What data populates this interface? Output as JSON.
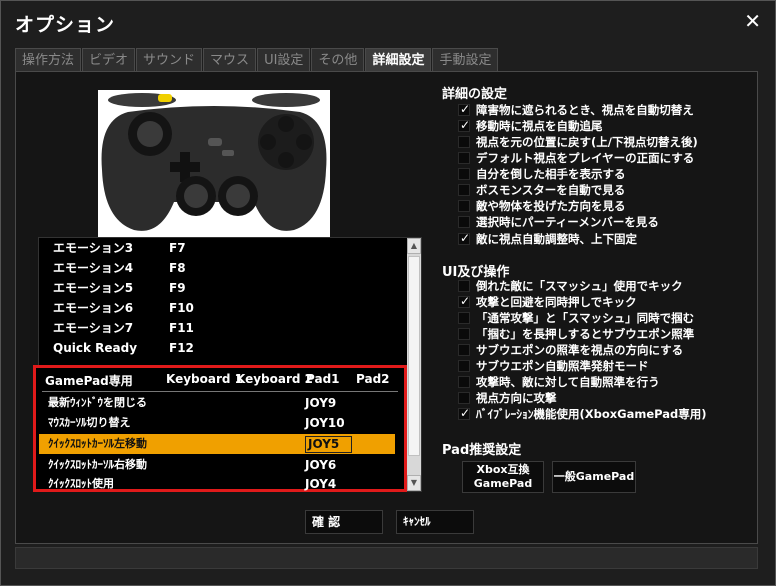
{
  "window": {
    "title": "オプション",
    "close_glyph": "✕"
  },
  "tabs": [
    {
      "label": "操作方法"
    },
    {
      "label": "ビデオ"
    },
    {
      "label": "サウンド"
    },
    {
      "label": "マウス"
    },
    {
      "label": "UI設定"
    },
    {
      "label": "その他"
    },
    {
      "label": "詳細設定"
    },
    {
      "label": "手動設定"
    }
  ],
  "keylist": {
    "rows": [
      {
        "name": "エモーション3",
        "key": "F7"
      },
      {
        "name": "エモーション4",
        "key": "F8"
      },
      {
        "name": "エモーション5",
        "key": "F9"
      },
      {
        "name": "エモーション6",
        "key": "F10"
      },
      {
        "name": "エモーション7",
        "key": "F11"
      },
      {
        "name": "Quick Ready",
        "key": "F12"
      }
    ],
    "scroll_up": "▲",
    "scroll_down": "▼"
  },
  "gamepad": {
    "headers": {
      "action": "GamePad専用",
      "kb1": "Keyboard 1",
      "kb2": "Keyboard 2",
      "pad1": "Pad1",
      "pad2": "Pad2"
    },
    "rows": [
      {
        "name": "最新ｳｨﾝﾄﾞｳを閉じる",
        "pad1": "JOY9"
      },
      {
        "name": "ﾏｳｽｶｰｿﾙ切り替え",
        "pad1": "JOY10"
      },
      {
        "name": "ｸｲｯｸｽﾛｯﾄｶｰｿﾙ左移動",
        "pad1": "JOY5"
      },
      {
        "name": "ｸｲｯｸｽﾛｯﾄｶｰｿﾙ右移動",
        "pad1": "JOY6"
      },
      {
        "name": "ｸｲｯｸｽﾛｯﾄ使用",
        "pad1": "JOY4"
      }
    ]
  },
  "detail": {
    "title": "詳細の設定",
    "options": [
      {
        "label": "障害物に遮られるとき、視点を自動切替え",
        "checked": true
      },
      {
        "label": "移動時に視点を自動追尾",
        "checked": true
      },
      {
        "label": "視点を元の位置に戻す(上/下視点切替え後)",
        "checked": false
      },
      {
        "label": "デフォルト視点をプレイヤーの正面にする",
        "checked": false
      },
      {
        "label": "自分を倒した相手を表示する",
        "checked": false
      },
      {
        "label": "ボスモンスターを自動で見る",
        "checked": false
      },
      {
        "label": "敵や物体を投げた方向を見る",
        "checked": false
      },
      {
        "label": "選択時にパーティーメンバーを見る",
        "checked": false
      },
      {
        "label": "敵に視点自動調整時、上下固定",
        "checked": true
      }
    ]
  },
  "ui_ops": {
    "title": "UI及び操作",
    "options": [
      {
        "label": "倒れた敵に「スマッシュ」使用でキック",
        "checked": false
      },
      {
        "label": "攻撃と回避を同時押しでキック",
        "checked": true
      },
      {
        "label": "「通常攻撃」と「スマッシュ」同時で掴む",
        "checked": false
      },
      {
        "label": "「掴む」を長押しするとサブウエポン照準",
        "checked": false
      },
      {
        "label": "サブウエポンの照準を視点の方向にする",
        "checked": false
      },
      {
        "label": "サブウエポン自動照準発射モード",
        "checked": false
      },
      {
        "label": "攻撃時、敵に対して自動照準を行う",
        "checked": false
      },
      {
        "label": "視点方向に攻撃",
        "checked": false
      },
      {
        "label": "ﾊﾞｲﾌﾞﾚｰｼｮﾝ機能使用(XboxGamePad専用)",
        "checked": true
      }
    ]
  },
  "pad_preset": {
    "title": "Pad推奨設定",
    "xbox_label_1": "Xbox互換",
    "xbox_label_2": "GamePad",
    "generic_label": "一般GamePad"
  },
  "footer": {
    "ok_label": "確 認",
    "cancel_label": "ｷｬﾝｾﾙ"
  },
  "colors": {
    "selection": "#f0a000",
    "highlight_border": "#e01a1a",
    "gamepad_yellow": "#f0d000"
  }
}
